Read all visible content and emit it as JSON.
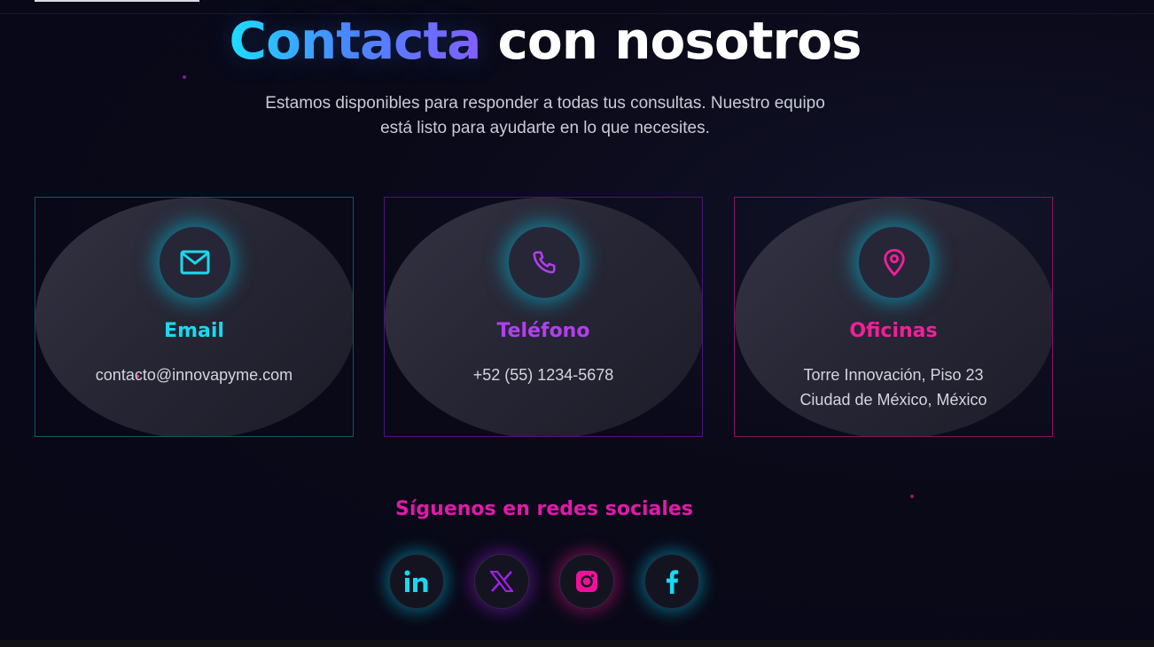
{
  "header": {
    "title_highlight": "Contacta",
    "title_rest": "con nosotros",
    "subtitle": "Estamos disponibles para responder a todas tus consultas. Nuestro equipo está listo para ayudarte en lo que necesites."
  },
  "cards": [
    {
      "title": "Email",
      "lines": [
        "contacto@innovapyme.com"
      ],
      "icon": "mail-icon",
      "color": "#19d9f0"
    },
    {
      "title": "Teléfono",
      "lines": [
        "+52 (55) 1234-5678"
      ],
      "icon": "phone-icon",
      "color": "#b23ff0"
    },
    {
      "title": "Oficinas",
      "lines": [
        "Torre Innovación, Piso 23",
        "Ciudad de México, México"
      ],
      "icon": "map-pin-icon",
      "color": "#f0209a"
    }
  ],
  "social": {
    "title": "Síguenos en redes sociales",
    "links": [
      {
        "name": "LinkedIn",
        "icon": "linkedin-icon",
        "color": "#19d9f0"
      },
      {
        "name": "X",
        "icon": "x-icon",
        "color": "#a41fe8"
      },
      {
        "name": "Instagram",
        "icon": "instagram-icon",
        "color": "#f0109a"
      },
      {
        "name": "Facebook",
        "icon": "facebook-icon",
        "color": "#19d9f0"
      }
    ]
  },
  "colors": {
    "background": "#090918",
    "accent_cyan": "#19d9f0",
    "accent_purple": "#b23ff0",
    "accent_pink": "#f0209a"
  }
}
